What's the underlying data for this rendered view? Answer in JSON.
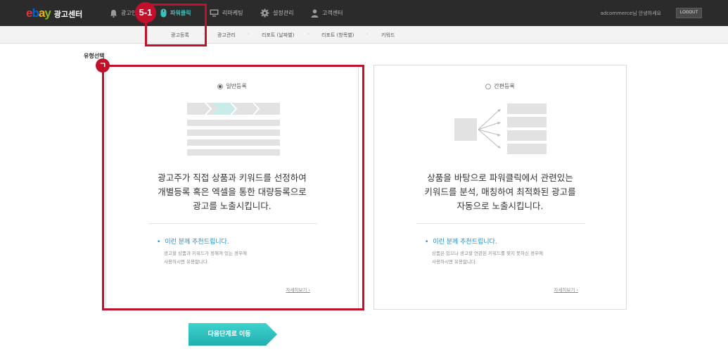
{
  "header": {
    "logo_ebay": [
      "e",
      "b",
      "a",
      "y"
    ],
    "brand": "광고센터",
    "nav": [
      {
        "label": "광고인",
        "icon": "bell-icon"
      },
      {
        "label": "파워클릭",
        "icon": "mouse-icon",
        "active": true
      },
      {
        "label": "리마케팅",
        "icon": "monitor-icon"
      },
      {
        "label": "설정관리",
        "icon": "gear-icon"
      },
      {
        "label": "고객센터",
        "icon": "person-icon"
      }
    ],
    "user_text": "adcommerce님 안녕하세요",
    "logout": "LOGOUT"
  },
  "subnav": [
    "광고등록",
    "광고관리",
    "리포트 (날짜별)",
    "리포트 (항목별)",
    "키워드"
  ],
  "section_title": "유형선택",
  "cards": [
    {
      "option": "일반등록",
      "selected": true,
      "desc": [
        "광고주가 직접 상품과 키워드를 선정하여",
        "개별등록 혹은 엑셀을 통한 대량등록으로",
        "광고를 노출시킵니다."
      ],
      "rec_title": "이런 분께 추천드립니다.",
      "rec_text": [
        "광고할 상품과 키워드가 정해져 있는 경우에",
        "사용하시면 유용합니다."
      ],
      "more": "자세히보기"
    },
    {
      "option": "간편등록",
      "selected": false,
      "desc": [
        "상품을 바탕으로 파워클릭에서 관련있는",
        "키워드를 분석, 매칭하여 최적화된 광고를",
        "자동으로 노출시킵니다."
      ],
      "rec_title": "이런 분께 추천드립니다.",
      "rec_text": [
        "상품은 있으나 광고할 연관된 키워드를 찾지 못하신 경우에",
        "사용하시면 유용합니다."
      ],
      "more": "자세히보기"
    }
  ],
  "next_button": "다음단계로 이동",
  "annotations": {
    "badge_nav": "5-1",
    "badge_card": "ㄱ"
  },
  "colors": {
    "accent": "#32c5c0",
    "annotation": "#c1102b",
    "link": "#1f8fcf",
    "topbar": "#2b2b2b"
  }
}
